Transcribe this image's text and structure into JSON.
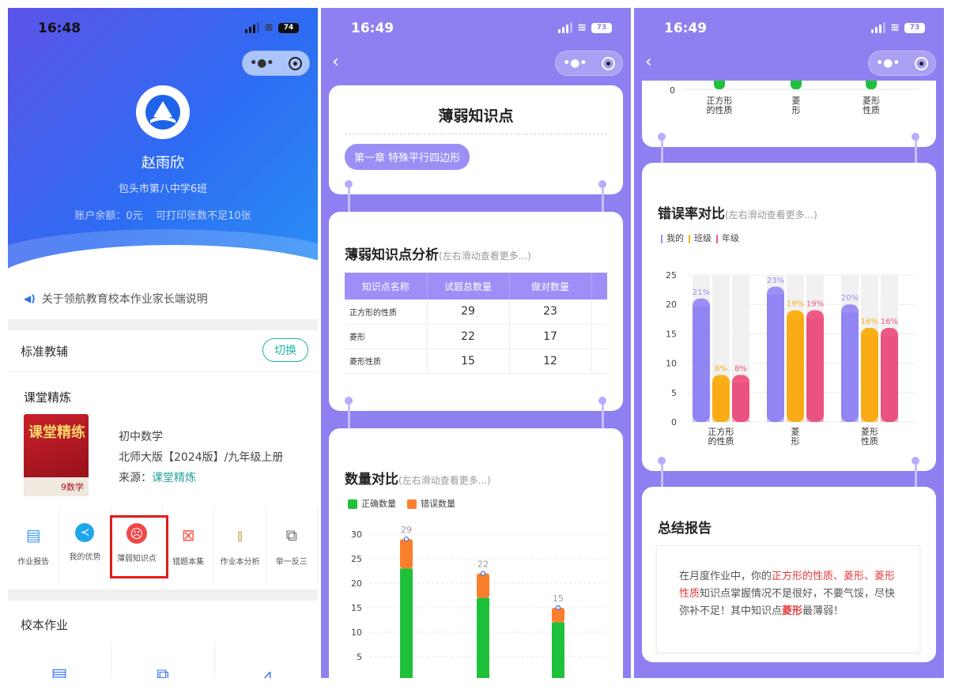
{
  "status": [
    {
      "time": "16:48",
      "battery": "74"
    },
    {
      "time": "16:49",
      "battery": "73"
    },
    {
      "time": "16:49",
      "battery": "73"
    }
  ],
  "profile": {
    "name": "赵雨欣",
    "school": "包头市第八中学6班",
    "balance": "账户余额：0元",
    "print": "可打印张数不足10张"
  },
  "notice": "关于领航教育校本作业家长端说明",
  "standard": {
    "label": "标准教辅",
    "switch": "切换"
  },
  "course": {
    "title": "课堂精炼",
    "cover_title": "课堂精练",
    "cover_grade": "9数学",
    "subject": "初中数学",
    "edition": "北师大版【2024版】/九年级上册",
    "source_label": "来源：",
    "source": "课堂精炼"
  },
  "tools": [
    "作业报告",
    "我的优势",
    "薄弱知识点",
    "错题本集",
    "作业本分析",
    "举一反三"
  ],
  "school_hw": "校本作业",
  "weak": {
    "title": "薄弱知识点",
    "chapter": "第一章 特殊平行四边形"
  },
  "analysis": {
    "title": "薄弱知识点分析",
    "hint": "(左右滑动查看更多...)",
    "headers": [
      "知识点名称",
      "试题总数量",
      "做对数量"
    ],
    "rows": [
      {
        "name": "正方形的性质",
        "total": "29",
        "correct": "23"
      },
      {
        "name": "菱形",
        "total": "22",
        "correct": "17"
      },
      {
        "name": "菱形性质",
        "total": "15",
        "correct": "12"
      }
    ]
  },
  "qty_chart_title": "数量对比",
  "qty_chart_hint": "(左右滑动查看更多...)",
  "err_chart_title": "错误率对比",
  "err_chart_hint": "(左右滑动查看更多...)",
  "colors": {
    "green": "#1ec139",
    "orange": "#fa7f2d",
    "mine": "#9b8ff6",
    "cls": "#fbb116",
    "grade": "#ef5a85"
  },
  "chart_data": [
    {
      "type": "bar",
      "title": "数量对比",
      "subtitle": "(左右滑动查看更多...)",
      "stacked": true,
      "categories": [
        "正方形的性质",
        "菱形",
        "菱形性质"
      ],
      "series": [
        {
          "name": "正确数量",
          "values": [
            23,
            17,
            12
          ]
        },
        {
          "name": "错误数量",
          "values": [
            6,
            5,
            3
          ]
        }
      ],
      "totals": [
        29,
        22,
        15
      ],
      "yticks": [
        5,
        10,
        15,
        20,
        25,
        30
      ],
      "ylim": [
        0,
        30
      ],
      "grid": true,
      "legend": "top-left"
    },
    {
      "type": "bar",
      "title": "错误率对比",
      "subtitle": "(左右滑动查看更多...)",
      "categories": [
        "正方形的性质",
        "菱形",
        "菱形性质"
      ],
      "category_labels": [
        [
          "正方形",
          "的性质"
        ],
        [
          "菱",
          "形"
        ],
        [
          "菱形",
          "性质"
        ]
      ],
      "series": [
        {
          "name": "我的",
          "values": [
            21,
            23,
            20
          ]
        },
        {
          "name": "班级",
          "values": [
            8,
            19,
            16
          ]
        },
        {
          "name": "年级",
          "values": [
            8,
            19,
            16
          ]
        }
      ],
      "yticks": [
        0,
        5,
        10,
        15,
        20,
        25
      ],
      "ylim": [
        0,
        25
      ],
      "grid": true,
      "legend": "top-left"
    }
  ],
  "summary": {
    "title": "总结报告",
    "p1": "在月度作业中，你的",
    "weak_list": "正方形的性质、菱形、菱形性质",
    "p2": "知识点掌握情况不是很好，不要气馁，尽快弥补不足！其中知识点",
    "weakest": "菱形",
    "p3": "最薄弱！"
  }
}
